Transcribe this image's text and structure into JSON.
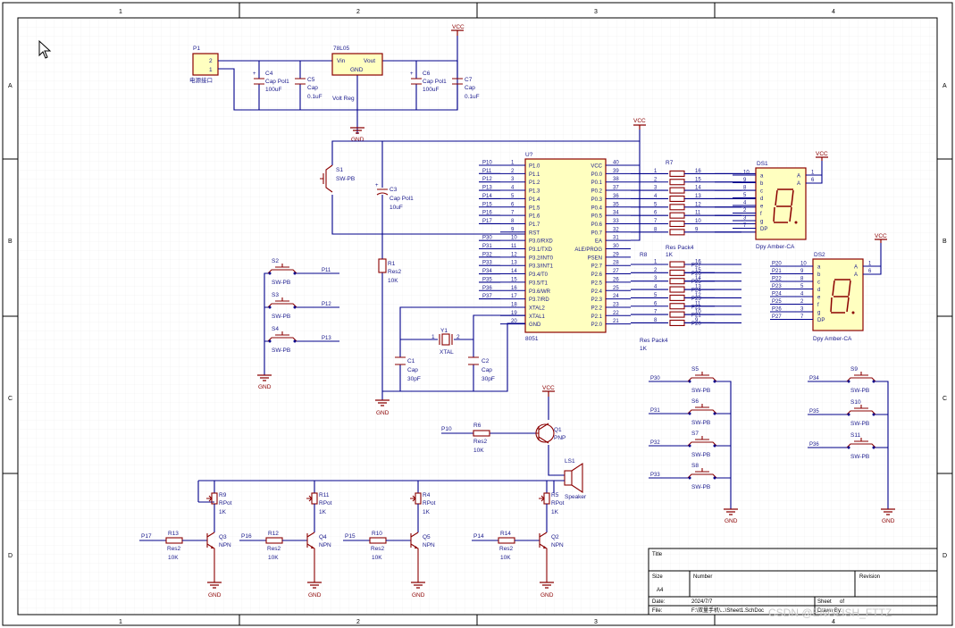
{
  "sheet": {
    "zone_cols": [
      "1",
      "2",
      "3",
      "4"
    ],
    "zone_rows": [
      "A",
      "B",
      "C",
      "D"
    ]
  },
  "power": {
    "vcc": "VCC",
    "gnd": "GND"
  },
  "p1": {
    "ref": "P1",
    "pins": [
      "2",
      "1"
    ],
    "name": "电源接口"
  },
  "reg": {
    "ref": "78L05",
    "vin": "Vin",
    "vout": "Vout",
    "gnd": "GND",
    "name": "Volt Reg"
  },
  "c4": {
    "ref": "C4",
    "type": "Cap Pol1",
    "value": "100uF"
  },
  "c5": {
    "ref": "C5",
    "type": "Cap",
    "value": "0.1uF"
  },
  "c6": {
    "ref": "C6",
    "type": "Cap Pol1",
    "value": "100uF"
  },
  "c7": {
    "ref": "C7",
    "type": "Cap",
    "value": "0.1uF"
  },
  "s1": {
    "ref": "S1",
    "type": "SW-PB"
  },
  "c3": {
    "ref": "C3",
    "type": "Cap Pol1",
    "value": "10uF"
  },
  "r1": {
    "ref": "R1",
    "type": "Res2",
    "value": "10K"
  },
  "y1": {
    "ref": "Y1",
    "type": "XTAL",
    "pins": [
      "1",
      "2"
    ]
  },
  "c1": {
    "ref": "C1",
    "type": "Cap",
    "value": "30pF"
  },
  "c2": {
    "ref": "C2",
    "type": "Cap",
    "value": "30pF"
  },
  "u1": {
    "ref": "U?",
    "name": "8051",
    "left_nets": [
      "P10",
      "P11",
      "P12",
      "P13",
      "P14",
      "P15",
      "P16",
      "P17",
      "",
      "P30",
      "P31",
      "P32",
      "P33",
      "P34",
      "P35",
      "P36",
      "P37",
      "",
      "",
      ""
    ],
    "left_nums": [
      "1",
      "2",
      "3",
      "4",
      "5",
      "6",
      "7",
      "8",
      "9",
      "10",
      "11",
      "12",
      "13",
      "14",
      "15",
      "16",
      "17",
      "18",
      "19",
      "20"
    ],
    "left_names": [
      "P1.0",
      "P1.1",
      "P1.2",
      "P1.3",
      "P1.4",
      "P1.5",
      "P1.6",
      "P1.7",
      "RST",
      "P3.0/RXD",
      "P3.1/TXD",
      "P3.2/INT0",
      "P3.3/INT1",
      "P3.4/T0",
      "P3.5/T1",
      "P3.6/WR",
      "P3.7/RD",
      "XTAL2",
      "XTAL1",
      "GND"
    ],
    "right_nums": [
      "40",
      "39",
      "38",
      "37",
      "36",
      "35",
      "34",
      "33",
      "32",
      "31",
      "30",
      "29",
      "28",
      "27",
      "26",
      "25",
      "24",
      "23",
      "22",
      "21"
    ],
    "right_names": [
      "VCC",
      "P0.0",
      "P0.1",
      "P0.2",
      "P0.3",
      "P0.4",
      "P0.5",
      "P0.6",
      "P0.7",
      "EA",
      "ALE/PROG",
      "PSEN",
      "P2.7",
      "P2.6",
      "P2.5",
      "P2.4",
      "P2.3",
      "P2.2",
      "P2.1",
      "P2.0"
    ]
  },
  "r7": {
    "ref": "R7",
    "name": "Res Pack4",
    "left_nums": [
      "1",
      "2",
      "3",
      "4",
      "5",
      "6",
      "7",
      "8"
    ],
    "right_nums": [
      "16",
      "15",
      "14",
      "13",
      "12",
      "11",
      "10",
      "9"
    ]
  },
  "r8": {
    "ref": "R8",
    "value_top": "1K",
    "name": "Res Pack4",
    "value": "1K",
    "left_nums": [
      "1",
      "2",
      "3",
      "4",
      "5",
      "6",
      "7",
      "8"
    ],
    "right_nums": [
      "16",
      "15",
      "14",
      "13",
      "12",
      "11",
      "10",
      "9"
    ],
    "nets": [
      "P27",
      "P26",
      "P25",
      "P24",
      "P23",
      "P22",
      "P21",
      "P20"
    ]
  },
  "ds1": {
    "ref": "DS1",
    "name": "Dpy Amber-CA",
    "seg_labels": [
      "a",
      "b",
      "c",
      "d",
      "e",
      "f",
      "g",
      "DP"
    ],
    "seg_pins": [
      "10",
      "9",
      "8",
      "5",
      "4",
      "2",
      "3",
      "7"
    ],
    "anode": [
      "A",
      "A"
    ],
    "anode_pins": [
      "1",
      "6"
    ]
  },
  "ds2": {
    "ref": "DS2",
    "name": "Dpy Amber-CA",
    "nets": [
      "P20",
      "P21",
      "P22",
      "P23",
      "P24",
      "P25",
      "P26",
      "P27"
    ],
    "seg_labels": [
      "a",
      "b",
      "c",
      "d",
      "e",
      "f",
      "g",
      "DP"
    ],
    "seg_pins": [
      "10",
      "9",
      "8",
      "5",
      "4",
      "2",
      "3",
      "7"
    ],
    "anode": [
      "A",
      "A"
    ],
    "anode_pins": [
      "1",
      "6"
    ]
  },
  "keys_left": [
    {
      "ref": "S2",
      "type": "SW-PB",
      "net": "P11"
    },
    {
      "ref": "S3",
      "type": "SW-PB",
      "net": "P12"
    },
    {
      "ref": "S4",
      "type": "SW-PB",
      "net": "P13"
    }
  ],
  "keys_mid": [
    {
      "ref": "S5",
      "type": "SW-PB",
      "net": "P30"
    },
    {
      "ref": "S6",
      "type": "SW-PB",
      "net": "P31"
    },
    {
      "ref": "S7",
      "type": "SW-PB",
      "net": "P32"
    },
    {
      "ref": "S8",
      "type": "SW-PB",
      "net": "P33"
    }
  ],
  "keys_right": [
    {
      "ref": "S9",
      "type": "SW-PB",
      "net": "P34"
    },
    {
      "ref": "S10",
      "type": "SW-PB",
      "net": "P35"
    },
    {
      "ref": "S11",
      "type": "SW-PB",
      "net": "P36"
    }
  ],
  "buzzer": {
    "r6": {
      "ref": "R6",
      "type": "Res2",
      "value": "10K",
      "net": "P10"
    },
    "q1": {
      "ref": "Q1",
      "type": "PNP"
    },
    "ls1": {
      "ref": "LS1",
      "type": "Speaker"
    }
  },
  "drivers": [
    {
      "pot": "R9",
      "pot_type": "RPot",
      "pot_val": "1K",
      "q": "Q3",
      "q_type": "NPN",
      "r": "R13",
      "r_type": "Res2",
      "r_val": "10K",
      "net": "P17"
    },
    {
      "pot": "R11",
      "pot_type": "RPot",
      "pot_val": "1K",
      "q": "Q4",
      "q_type": "NPN",
      "r": "R12",
      "r_type": "Res2",
      "r_val": "10K",
      "net": "P16"
    },
    {
      "pot": "R4",
      "pot_type": "RPot",
      "pot_val": "1K",
      "q": "Q5",
      "q_type": "NPN",
      "r": "R10",
      "r_type": "Res2",
      "r_val": "10K",
      "net": "P15"
    },
    {
      "pot": "R5",
      "pot_type": "RPot",
      "pot_val": "1K",
      "q": "Q2",
      "q_type": "NPN",
      "r": "R14",
      "r_type": "Res2",
      "r_val": "10K",
      "net": "P14"
    }
  ],
  "title_block": {
    "title": "Title",
    "size": "Size",
    "size_val": "A4",
    "number": "Number",
    "revision": "Revision",
    "date": "Date:",
    "date_val": "2024/7/7",
    "sheet": "Sheet",
    "sheet_of": "of",
    "file": "File:",
    "file_val": "F:\\双量手机\\...\\Sheet1.SchDoc",
    "drawn": "Drawn By:"
  },
  "watermark": "CSDN @ENGLISH_FTTZ"
}
